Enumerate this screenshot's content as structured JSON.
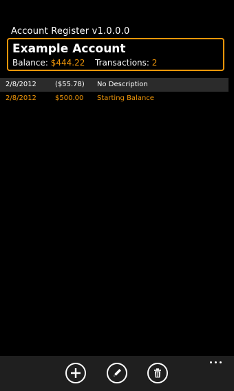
{
  "app": {
    "title": "Account Register v1.0.0.0"
  },
  "account": {
    "name": "Example Account",
    "balance_label": "Balance:",
    "balance_value": "$444.22",
    "transactions_label": "Transactions:",
    "transactions_value": "2"
  },
  "transactions": [
    {
      "date": "2/8/2012",
      "amount": "($55.78)",
      "description": "No Description",
      "selected": true
    },
    {
      "date": "2/8/2012",
      "amount": "$500.00",
      "description": "Starting Balance",
      "selected": false
    }
  ],
  "app_bar": {
    "buttons": [
      {
        "name": "add-icon"
      },
      {
        "name": "edit-icon"
      },
      {
        "name": "delete-icon"
      }
    ],
    "more_icon": "ellipsis-icon"
  },
  "colors": {
    "accent": "#f09609",
    "background": "#000000",
    "selected_row": "#2b2b2b",
    "app_bar": "#1f1f1f"
  }
}
